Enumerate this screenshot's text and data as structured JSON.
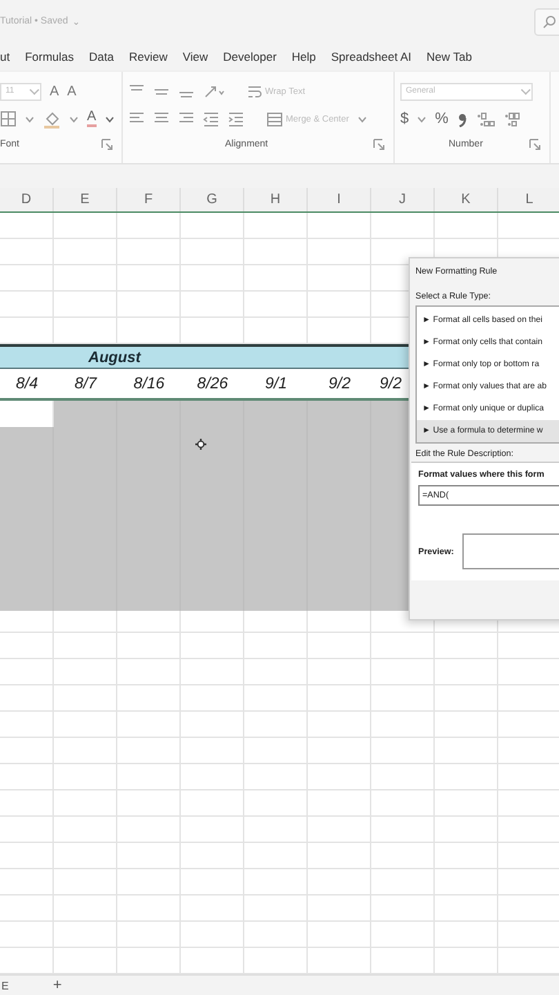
{
  "title_bar": {
    "title": "Tutorial • Saved",
    "caret": "⌄"
  },
  "menu": [
    {
      "label": "ut"
    },
    {
      "label": "Formulas"
    },
    {
      "label": "Data"
    },
    {
      "label": "Review"
    },
    {
      "label": "View"
    },
    {
      "label": "Developer"
    },
    {
      "label": "Help"
    },
    {
      "label": "Spreadsheet AI"
    },
    {
      "label": "New Tab"
    }
  ],
  "ribbon": {
    "font": {
      "size": "11",
      "grow": "A",
      "shrink": "A",
      "color_letter": "A",
      "label": "Font"
    },
    "alignment": {
      "wrap": "Wrap Text",
      "merge": "Merge & Center",
      "label": "Alignment"
    },
    "number": {
      "format": "General",
      "currency": "$",
      "percent": "%",
      "label": "Number"
    }
  },
  "sheet": {
    "columns": [
      "D",
      "E",
      "F",
      "G",
      "H",
      "I",
      "J",
      "K",
      "L"
    ],
    "band": "August",
    "dates": [
      "8/4",
      "8/7",
      "8/16",
      "8/26",
      "9/1",
      "9/2",
      "9/2"
    ],
    "rows": [
      {
        "shaded": [
          false,
          true,
          true,
          true,
          true,
          true,
          true
        ]
      },
      {
        "shaded": [
          true,
          true,
          true,
          true,
          true,
          true,
          true
        ]
      },
      {
        "shaded": [
          true,
          true,
          true,
          true,
          true,
          true,
          true
        ]
      },
      {
        "shaded": [
          true,
          true,
          true,
          true,
          true,
          true,
          true
        ]
      },
      {
        "shaded": [
          true,
          true,
          true,
          true,
          true,
          true,
          true
        ]
      },
      {
        "shaded": [
          true,
          true,
          true,
          true,
          true,
          true,
          true
        ]
      },
      {
        "shaded": [
          true,
          true,
          true,
          true,
          true,
          true,
          true
        ]
      },
      {
        "shaded": [
          true,
          true,
          true,
          true,
          true,
          true,
          true
        ]
      }
    ]
  },
  "dialog": {
    "title": "New Formatting Rule",
    "select_label": "Select a Rule Type:",
    "rule_types": [
      {
        "label": "► Format all cells based on thei",
        "selected": false
      },
      {
        "label": "► Format only cells that contain",
        "selected": false
      },
      {
        "label": "► Format only top or bottom ra",
        "selected": false
      },
      {
        "label": "► Format only values that are ab",
        "selected": false
      },
      {
        "label": "► Format only unique or duplica",
        "selected": false
      },
      {
        "label": "► Use a formula to determine w",
        "selected": true
      }
    ],
    "edit_label": "Edit the Rule Description:",
    "formula_label": "Format values where this form",
    "formula": "=AND(",
    "preview_label": "Preview:"
  },
  "sheet_tabs": {
    "tab": "E",
    "add": "+"
  }
}
